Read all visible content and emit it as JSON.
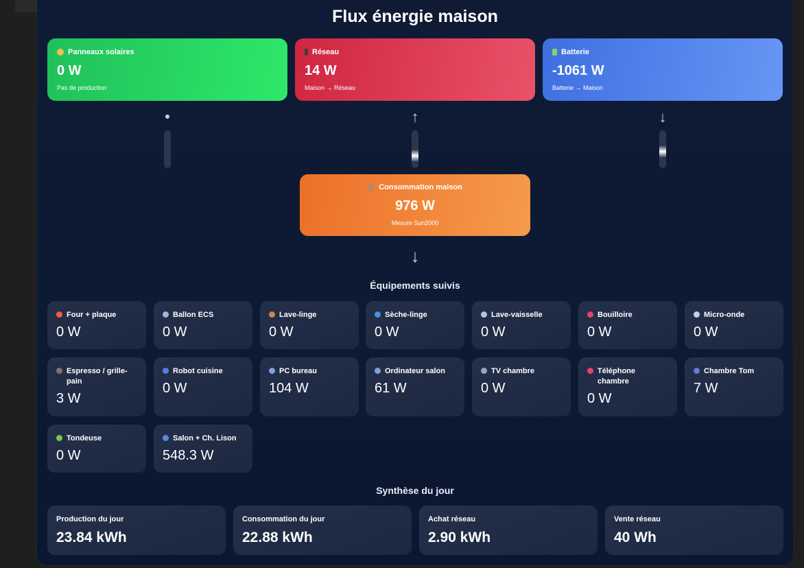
{
  "title": "Flux énergie maison",
  "sources": {
    "solar": {
      "label": "Panneaux solaires",
      "value": "0 W",
      "sub": "Pas de production",
      "icon": "sun-icon"
    },
    "grid": {
      "label": "Réseau",
      "value": "14 W",
      "sub": "Maison → Réseau",
      "icon": "plug-icon"
    },
    "battery": {
      "label": "Batterie",
      "value": "-1061 W",
      "sub": "Batterie → Maison",
      "icon": "battery-icon"
    }
  },
  "flows": {
    "solar": "•",
    "grid": "↑",
    "battery": "↓",
    "house": "↓"
  },
  "house": {
    "label": "Consommation maison",
    "value": "976 W",
    "sub": "Mesure Sun2000",
    "icon": "house-icon"
  },
  "equipment_title": "Équipements suivis",
  "equipment": [
    {
      "label": "Four + plaque",
      "value": "0 W",
      "icon": "flame-icon",
      "color": "#f25d3c"
    },
    {
      "label": "Ballon ECS",
      "value": "0 W",
      "icon": "shower-icon",
      "color": "#9fb6d8"
    },
    {
      "label": "Lave-linge",
      "value": "0 W",
      "icon": "basket-icon",
      "color": "#c58a4a"
    },
    {
      "label": "Sèche-linge",
      "value": "0 W",
      "icon": "dryer-icon",
      "color": "#4b8ee8"
    },
    {
      "label": "Lave-vaisselle",
      "value": "0 W",
      "icon": "dishes-icon",
      "color": "#b9c3d6"
    },
    {
      "label": "Bouilloire",
      "value": "0 W",
      "icon": "kettle-icon",
      "color": "#e8406c"
    },
    {
      "label": "Micro-onde",
      "value": "0 W",
      "icon": "microwave-icon",
      "color": "#c8cfe0"
    },
    {
      "label": "Espresso / grille-pain",
      "value": "3 W",
      "icon": "coffee-icon",
      "color": "#8a6f6a"
    },
    {
      "label": "Robot cuisine",
      "value": "0 W",
      "icon": "robot-icon",
      "color": "#5a7be0"
    },
    {
      "label": "PC bureau",
      "value": "104 W",
      "icon": "laptop-icon",
      "color": "#7fa2d8"
    },
    {
      "label": "Ordinateur salon",
      "value": "61 W",
      "icon": "desktop-icon",
      "color": "#7fa2d8"
    },
    {
      "label": "TV chambre",
      "value": "0 W",
      "icon": "tv-icon",
      "color": "#9aa6bc"
    },
    {
      "label": "Téléphone chambre",
      "value": "0 W",
      "icon": "phone-icon",
      "color": "#e8406c"
    },
    {
      "label": "Chambre Tom",
      "value": "7 W",
      "icon": "bed-icon",
      "color": "#6a78d8"
    },
    {
      "label": "Tondeuse",
      "value": "0 W",
      "icon": "grass-icon",
      "color": "#7cc84a"
    },
    {
      "label": "Salon + Ch. Lison",
      "value": "548.3 W",
      "icon": "sofa-icon",
      "color": "#5a86d8"
    }
  ],
  "summary_title": "Synthèse du jour",
  "summary": [
    {
      "label": "Production du jour",
      "value": "23.84 kWh"
    },
    {
      "label": "Consommation du jour",
      "value": "22.88 kWh"
    },
    {
      "label": "Achat réseau",
      "value": "2.90 kWh"
    },
    {
      "label": "Vente réseau",
      "value": "40 Wh"
    }
  ],
  "colors": {
    "solar": "#2ee86a",
    "grid": "#e9526a",
    "battery": "#6796f5",
    "house": "#f69a4b",
    "panel": "#0f1b34"
  }
}
